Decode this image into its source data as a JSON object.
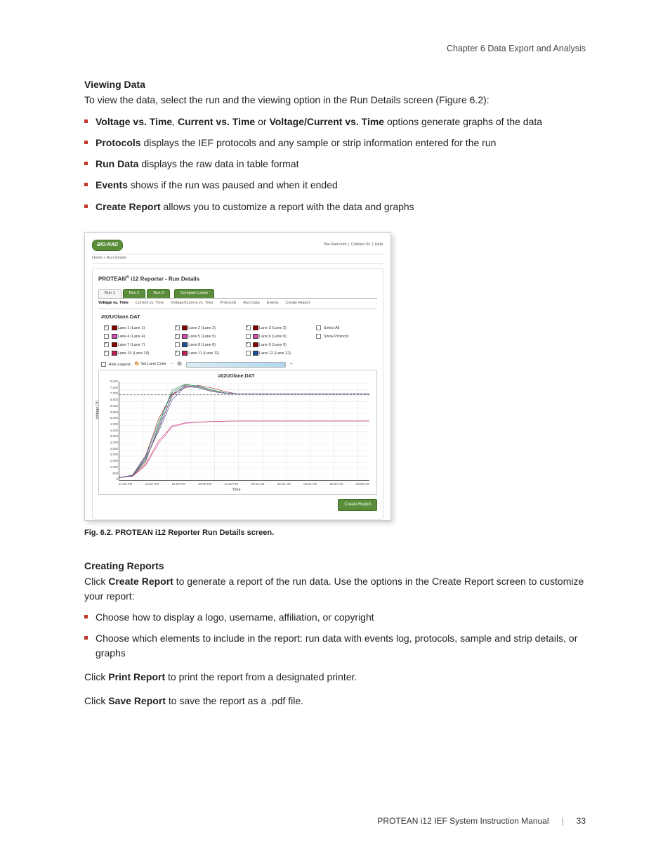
{
  "chapter_header": "Chapter 6 Data Export and Analysis",
  "viewing": {
    "title": "Viewing Data",
    "intro": "To view the data, select the run and the viewing option in the Run Details screen (Figure 6.2):",
    "bullets": [
      {
        "lead": "Voltage vs. Time",
        "mid1": ", ",
        "lead2": "Current vs. Time",
        "mid2": " or ",
        "lead3": "Voltage/Current vs. Time",
        "rest": " options generate graphs of the data"
      },
      {
        "lead": "Protocols",
        "rest": " displays the IEF protocols and any sample or strip information entered for the run"
      },
      {
        "lead": "Run Data",
        "rest": " displays the raw data in table format"
      },
      {
        "lead": "Events",
        "rest": " shows if the run was paused and when it ended"
      },
      {
        "lead": "Create Report",
        "rest": " allows you to customize a report with the data and graphs"
      }
    ]
  },
  "figure": {
    "logo": "BIO-RAD",
    "toplinks": [
      "Bio-Rad.com",
      "Contact Us",
      "Help"
    ],
    "breadcrumb": "Home » Run Details",
    "panel_title_prefix": "PROTEAN",
    "panel_title_sup": "®",
    "panel_title_rest": " i12    Reporter - Run Details",
    "run_tabs": [
      {
        "label": "Run 1",
        "active": false
      },
      {
        "label": "Run 2",
        "active": true
      },
      {
        "label": "Run 3",
        "active": true
      }
    ],
    "compare_label": "Compare Lanes",
    "view_tabs": [
      {
        "label": "Voltage vs. Time",
        "active": true
      },
      {
        "label": "Current vs. Time",
        "active": false
      },
      {
        "label": "Voltage/Current vs. Time",
        "active": false
      },
      {
        "label": "Protocols",
        "active": false
      },
      {
        "label": "Run Data",
        "active": false
      },
      {
        "label": "Events",
        "active": false
      },
      {
        "label": "Create Report",
        "active": false
      }
    ],
    "file_name": "#02UOlane.DAT",
    "lane_cols": [
      [
        {
          "checked": true,
          "color": "#8b0000",
          "label": "Lane 1 (Lane 1)"
        },
        {
          "checked": false,
          "color": "#d04faa",
          "label": "Lane 4 (Lane 4)"
        },
        {
          "checked": true,
          "color": "#8b0000",
          "label": "Lane 7 (Lane 7)"
        },
        {
          "checked": true,
          "color": "#c02050",
          "label": "Lane 10 (Lane 10)"
        }
      ],
      [
        {
          "checked": true,
          "color": "#8b0000",
          "label": "Lane 2 (Lane 2)"
        },
        {
          "checked": true,
          "color": "#d04faa",
          "label": "Lane 5 (Lane 5)"
        },
        {
          "checked": false,
          "color": "#1f4e9b",
          "label": "Lane 8 (Lane 8)"
        },
        {
          "checked": true,
          "color": "#c02050",
          "label": "Lane 11 (Lane 11)"
        }
      ],
      [
        {
          "checked": true,
          "color": "#8b0000",
          "label": "Lane 3 (Lane 3)"
        },
        {
          "checked": false,
          "color": "#d04faa",
          "label": "Lane 6 (Lane 6)"
        },
        {
          "checked": true,
          "color": "#8b0000",
          "label": "Lane 9 (Lane 9)"
        },
        {
          "checked": false,
          "color": "#1f4e9b",
          "label": "Lane 12 (Lane 12)"
        }
      ],
      [
        {
          "checked": false,
          "color": null,
          "label": "Select All"
        },
        {
          "checked": false,
          "color": null,
          "label": "Show Protocol"
        }
      ]
    ],
    "tools": {
      "hide_legend": "Hide Legend",
      "set_lane_color": "Set Lane Color",
      "zoom_out": "−",
      "zoom_in": "+"
    },
    "create_report_btn": "Create Report",
    "caption": "Fig. 6.2. PROTEAN i12 Reporter Run Details screen."
  },
  "chart_data": {
    "type": "line",
    "title": "#02UOlane.DAT",
    "xlabel": "Time",
    "ylabel": "Voltage (V)",
    "ylim": [
      0,
      8000
    ],
    "y_ticks": [
      "0",
      "500",
      "1,000",
      "1,500",
      "2,000",
      "2,500",
      "3,000",
      "3,500",
      "4,000",
      "4,500",
      "5,000",
      "5,500",
      "6,000",
      "6,500",
      "7,000",
      "7,500",
      "8,000"
    ],
    "x_ticks": [
      "14:00 PM",
      "16:00 PM",
      "18:00 PM",
      "20:00 PM",
      "22:00 PM",
      "00:00 AM",
      "02:00 AM",
      "04:00 AM",
      "06:00 AM",
      "08:00 AM"
    ],
    "reference_line_y": 7000,
    "x_index": [
      0,
      1,
      2,
      3,
      4,
      5,
      6,
      7,
      8,
      9,
      10,
      11,
      12,
      13,
      14,
      15,
      16,
      17,
      18,
      19
    ],
    "series": [
      {
        "name": "Lane 1",
        "color": "#8b0000",
        "values": [
          200,
          400,
          2000,
          5000,
          7000,
          7500,
          7700,
          7500,
          7200,
          7000,
          7000,
          7000,
          7000,
          7000,
          7000,
          7000,
          7000,
          7000,
          7000,
          7000
        ]
      },
      {
        "name": "Lane 2",
        "color": "#2e7d32",
        "values": [
          200,
          300,
          1500,
          4500,
          7300,
          7800,
          7600,
          7300,
          7100,
          7000,
          7000,
          7000,
          7000,
          7000,
          7000,
          7000,
          7000,
          7000,
          7000,
          7000
        ]
      },
      {
        "name": "Lane 3",
        "color": "#1f4e9b",
        "values": [
          200,
          350,
          1800,
          4000,
          6500,
          7600,
          7500,
          7200,
          7050,
          7000,
          7000,
          7000,
          7000,
          7000,
          7000,
          7000,
          7000,
          7000,
          7000,
          7000
        ]
      },
      {
        "name": "Lane 5",
        "color": "#d04faa",
        "values": [
          200,
          300,
          1200,
          3000,
          4300,
          4600,
          4700,
          4750,
          4780,
          4800,
          4800,
          4800,
          4800,
          4800,
          4800,
          4800,
          4800,
          4800,
          4800,
          4800
        ]
      },
      {
        "name": "Lane 7",
        "color": "#a0522d",
        "values": [
          200,
          350,
          1600,
          4200,
          6800,
          7700,
          7550,
          7250,
          7050,
          7000,
          7000,
          7000,
          7000,
          7000,
          7000,
          7000,
          7000,
          7000,
          7000,
          7000
        ]
      },
      {
        "name": "Lane 9",
        "color": "#00796b",
        "values": [
          200,
          400,
          1900,
          4700,
          7100,
          7750,
          7650,
          7350,
          7100,
          7000,
          7000,
          7000,
          7000,
          7000,
          7000,
          7000,
          7000,
          7000,
          7000,
          7000
        ]
      },
      {
        "name": "Lane 10",
        "color": "#c02050",
        "values": [
          200,
          300,
          1300,
          3200,
          4400,
          4650,
          4720,
          4760,
          4790,
          4800,
          4800,
          4800,
          4800,
          4800,
          4800,
          4800,
          4800,
          4800,
          4800,
          4800
        ]
      },
      {
        "name": "Lane 11",
        "color": "#6a5acd",
        "values": [
          200,
          350,
          1700,
          4300,
          6900,
          7650,
          7500,
          7200,
          7050,
          7000,
          7000,
          7000,
          7000,
          7000,
          7000,
          7000,
          7000,
          7000,
          7000,
          7000
        ]
      }
    ]
  },
  "creating": {
    "title": "Creating Reports",
    "intro_pre": "Click ",
    "intro_bold": "Create Report",
    "intro_post": " to generate a report of the run data. Use the options in the Create Report screen to customize your report:",
    "bullets": [
      "Choose how to display a logo, username, affiliation, or copyright",
      "Choose which elements to include in the report: run data with events log, protocols, sample and strip details, or graphs"
    ],
    "print_pre": "Click ",
    "print_bold": "Print Report",
    "print_post": " to print the report from a designated printer.",
    "save_pre": "Click ",
    "save_bold": "Save Report",
    "save_post": " to save the report as a .pdf file."
  },
  "footer": {
    "manual": "PROTEAN i12 IEF System Instruction Manual",
    "page": "33"
  }
}
